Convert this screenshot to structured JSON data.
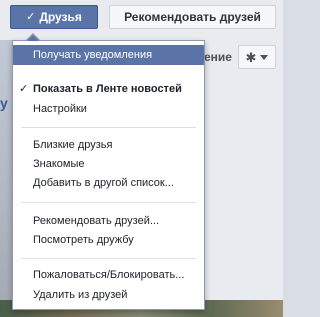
{
  "header": {
    "friends_label": "Друзья",
    "recommend_label": "Рекомендовать друзей"
  },
  "background": {
    "partial_label": "ение",
    "side_letter": "у"
  },
  "menu": {
    "notifications": "Получать уведомления",
    "show_in_feed": "Показать в Ленте новостей",
    "settings": "Настройки",
    "close_friends": "Близкие друзья",
    "acquaintances": "Знакомые",
    "add_to_list": "Добавить в другой список...",
    "recommend_friends": "Рекомендовать друзей...",
    "view_friendship": "Посмотреть дружбу",
    "report_block": "Пожаловаться/Блокировать...",
    "unfriend": "Удалить из друзей"
  },
  "icons": {
    "check": "✓",
    "gear": "✱"
  },
  "colors": {
    "accent": "#5b74a8",
    "accent_border": "#3b5998"
  }
}
